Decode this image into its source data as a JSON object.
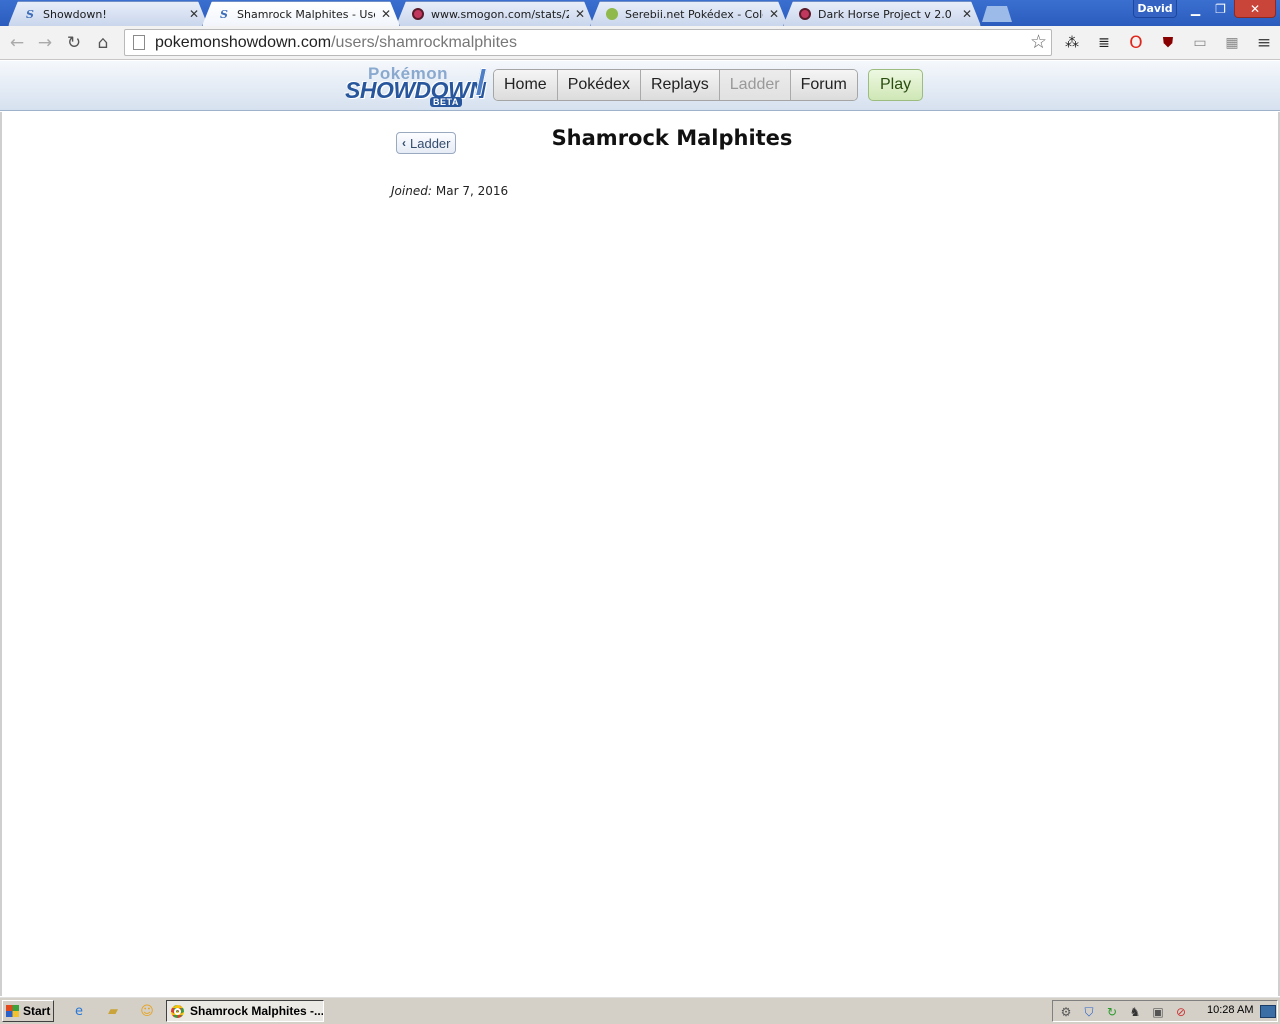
{
  "browser": {
    "tabs": [
      {
        "title": "Showdown!",
        "icon": "pokemon-showdown-favicon"
      },
      {
        "title": "Shamrock Malphites - Users",
        "icon": "pokemon-showdown-favicon",
        "active": true
      },
      {
        "title": "www.smogon.com/stats/201",
        "icon": "smogon-favicon"
      },
      {
        "title": "Serebii.net Pokédex - Colour",
        "icon": "serebii-favicon"
      },
      {
        "title": "Dark Horse Project v 2.0 (se",
        "icon": "smogon-favicon"
      }
    ],
    "profile_name": "David",
    "url_host": "pokemonshowdown.com",
    "url_path": "/users/shamrockmalphites"
  },
  "site": {
    "logo_top": "Pokémon",
    "logo_main": "SHOWDOWN",
    "logo_badge": "BETA",
    "nav": [
      {
        "label": "Home"
      },
      {
        "label": "Pokédex"
      },
      {
        "label": "Replays"
      },
      {
        "label": "Ladder",
        "current": true
      },
      {
        "label": "Forum"
      }
    ],
    "play_label": "Play"
  },
  "profile": {
    "back_label": "Ladder",
    "username": "Shamrock Malphites",
    "joined_label": "Joined:",
    "joined_date": "Mar 7, 2016"
  },
  "taskbar": {
    "start_label": "Start",
    "active_window": "Shamrock Malphites -...",
    "clock": "10:28 AM"
  },
  "colors": {
    "header_bg": "#d6e1ef",
    "logo_blue": "#28569c",
    "play_green": "#cfe7b6",
    "tabstrip_blue": "#2b5cbd"
  }
}
